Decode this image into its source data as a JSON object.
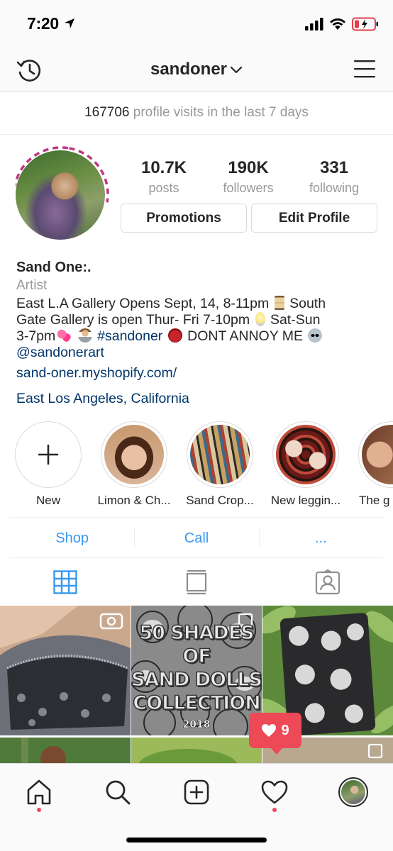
{
  "status_bar": {
    "time": "7:20",
    "icons": [
      "location-arrow-icon",
      "signal-icon",
      "wifi-icon",
      "battery-icon"
    ]
  },
  "header": {
    "username": "sandoner",
    "icons": [
      "history-icon",
      "chevron-down-icon",
      "menu-icon"
    ]
  },
  "insights": {
    "count": "167706",
    "text": "profile visits in the last 7 days"
  },
  "stats": [
    {
      "value": "10.7K",
      "label": "posts"
    },
    {
      "value": "190K",
      "label": "followers"
    },
    {
      "value": "331",
      "label": "following"
    }
  ],
  "buttons": {
    "promotions": "Promotions",
    "edit_profile": "Edit Profile"
  },
  "bio": {
    "name": "Sand One:.",
    "category": "Artist",
    "line1": "East L.A Gallery Opens Sept, 14, 8-11pm",
    "line1b": "South",
    "line2": "Gate Gallery is open Thur- Fri 7-10pm",
    "line2b": "Sat-Sun",
    "line3a": "3-7pm",
    "hashtag": "#sandoner",
    "line3b": "DONT ANNOY ME",
    "mention": "@sandonerart",
    "website": "sand-oner.myshopify.com/",
    "location": "East Los Angeles, California"
  },
  "highlights": [
    {
      "label": "New"
    },
    {
      "label": "Limon & Ch..."
    },
    {
      "label": "Sand Crop..."
    },
    {
      "label": "New  leggin..."
    },
    {
      "label": "The g"
    }
  ],
  "actions": {
    "shop": "Shop",
    "call": "Call",
    "more": "..."
  },
  "tabs": [
    "grid-icon",
    "feed-icon",
    "tagged-icon"
  ],
  "grid_post": {
    "line1": "50 SHADES",
    "line2": "OF",
    "line3": "SAND DOLLS",
    "line4": "COLLECTION",
    "year": "2018"
  },
  "notification": {
    "likes": "9"
  },
  "bottom_nav": [
    "home-icon",
    "search-icon",
    "new-post-icon",
    "activity-icon",
    "profile-avatar"
  ],
  "colors": {
    "link_blue": "#003569",
    "action_blue": "#3897f0",
    "notification_red": "#ed4956",
    "story_ring": "#c13584"
  }
}
